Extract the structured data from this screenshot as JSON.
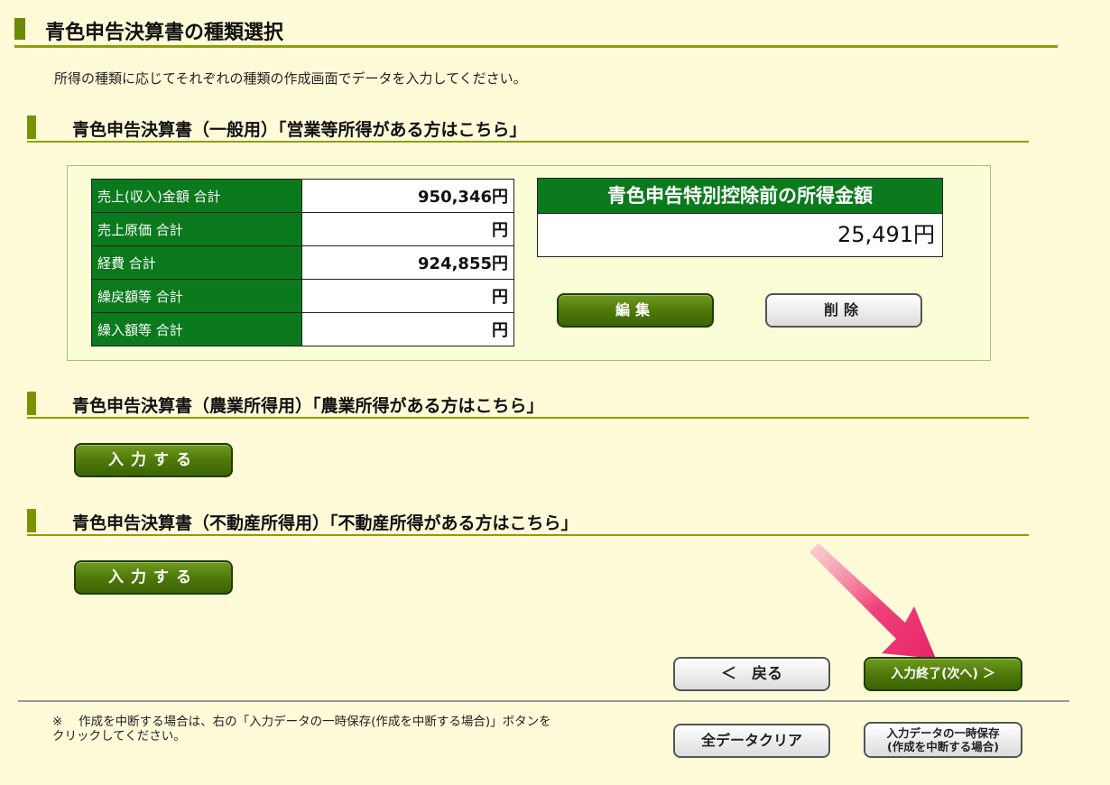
{
  "page": {
    "title": "青色申告決算書の種類選択",
    "intro": "所得の種類に応じてそれぞれの種類の作成画面でデータを入力してください。"
  },
  "sections": {
    "general": {
      "title": "青色申告決算書（一般用）「営業等所得がある方はこちら」",
      "rows": [
        {
          "label": "売上(収入)金額 合計",
          "value": "950,346円"
        },
        {
          "label": "売上原価 合計",
          "value": "円"
        },
        {
          "label": "経費 合計",
          "value": "924,855円"
        },
        {
          "label": "繰戻額等 合計",
          "value": "円"
        },
        {
          "label": "繰入額等 合計",
          "value": "円"
        }
      ],
      "income_title": "青色申告特別控除前の所得金額",
      "income_value": "25,491円",
      "edit_label": "編集",
      "delete_label": "削除"
    },
    "agriculture": {
      "title": "青色申告決算書（農業所得用）「農業所得がある方はこちら」",
      "input_label": "入力する"
    },
    "realestate": {
      "title": "青色申告決算書（不動産所得用）「不動産所得がある方はこちら」",
      "input_label": "入力する"
    }
  },
  "nav": {
    "back_label": "＜　戻る",
    "next_label": "入力終了(次へ) ＞"
  },
  "footer": {
    "note": "※　 作成を中断する場合は、右の「入力データの一時保存(作成を中断する場合)」ボタンをクリックしてください。",
    "clear_label": "全データクリア",
    "save_label_line1": "入力データの一時保存",
    "save_label_line2": "(作成を中断する場合)"
  },
  "colors": {
    "background": "#fffbd9",
    "accent_green": "#0b7a1d",
    "heading_rule": "#8aa100",
    "arrow": "#f0407a"
  },
  "icons": {
    "pointer": "arrow-pointer-icon"
  }
}
